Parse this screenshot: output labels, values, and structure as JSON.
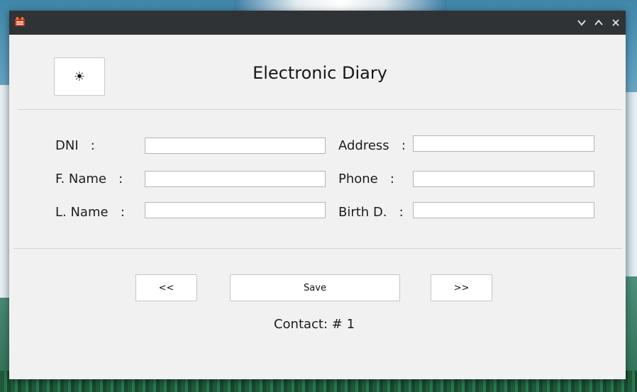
{
  "window": {
    "controls": {
      "minimize_icon": "chevron-down",
      "maximize_icon": "chevron-up",
      "close_icon": "close"
    }
  },
  "header": {
    "theme_button_symbol": "☀",
    "title": "Electronic Diary"
  },
  "form": {
    "dni_label": "DNI   :",
    "fname_label": "F. Name   :",
    "lname_label": "L. Name   :",
    "address_label": "Address   :",
    "phone_label": "Phone   :",
    "birth_label": "Birth D.   :",
    "dni_value": "",
    "fname_value": "",
    "lname_value": "",
    "address_value": "",
    "phone_value": "",
    "birth_value": ""
  },
  "nav": {
    "prev_label": "<<",
    "save_label": "Save",
    "next_label": ">>"
  },
  "status": {
    "contact_text": "Contact: # 1"
  },
  "colors": {
    "titlebar": "#2f3336",
    "window_bg": "#f1f1f1"
  }
}
